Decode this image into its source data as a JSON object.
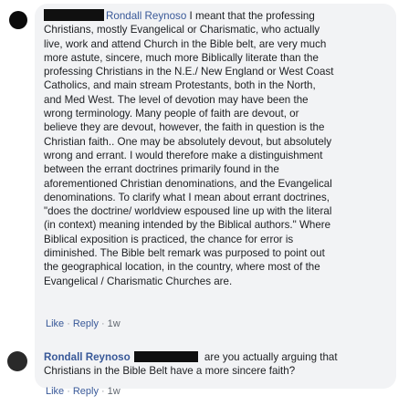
{
  "comments": [
    {
      "author": "Rondall Reynoso",
      "lines": [
        " I meant that the professing",
        "Christians, mostly Evangelical or Charismatic, who actually",
        "live, work and attend Church in the Bible belt, are very much",
        "more astute, sincere, much more Biblically literate than the",
        "professing Christians in the N.E./ New England or West Coast",
        "Catholics, and main stream Protestants, both in the North,",
        "and Med West. The level of devotion may have been the",
        "wrong terminology. Many people of faith are devout, or",
        "believe they are devout, however, the faith in question is the",
        "Christian faith.. One may be absolutely devout, but absolutely",
        "wrong and errant. I would therefore make a distinguishment",
        "between the errant doctrines primarily found in the",
        "aforementioned Christian denominations, and the Evangelical",
        "denominations. To clarify what I mean about errant doctrines,",
        "\"does the doctrine/ worldview espoused line up with the literal",
        "(in context) meaning intended by the Biblical authors.\" Where",
        "Biblical exposition is practiced, the chance for error is",
        "diminished. The Bible belt remark was purposed to point out",
        "the geographical location, in the country, where most of the",
        "Evangelical / Charismatic Churches are."
      ],
      "like": "Like",
      "reply": "Reply",
      "time": "1w"
    },
    {
      "author": "Rondall Reynoso",
      "lines": [
        " are you actually arguing that",
        "Christians in the Bible Belt have a more sincere faith?"
      ],
      "like": "Like",
      "reply": "Reply",
      "time": "1w"
    }
  ]
}
